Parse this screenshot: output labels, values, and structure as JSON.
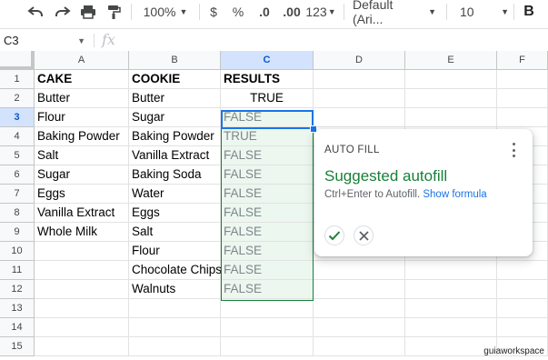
{
  "toolbar": {
    "zoom": "100%",
    "currency_symbol": "$",
    "percent_symbol": "%",
    "decrease_decimal": ".0",
    "increase_decimal": ".00",
    "number_format": "123",
    "font": "Default (Ari...",
    "font_size": "10",
    "bold": "B"
  },
  "formula_bar": {
    "cell_ref": "C3",
    "fx": "fx"
  },
  "columns": [
    "A",
    "B",
    "C",
    "D",
    "E",
    "F"
  ],
  "rows": [
    "1",
    "2",
    "3",
    "4",
    "5",
    "6",
    "7",
    "8",
    "9",
    "10",
    "11",
    "12",
    "13",
    "14",
    "15"
  ],
  "cells": {
    "A": [
      "CAKE",
      "Butter",
      "Flour",
      "Baking Powder",
      "Salt",
      "Sugar",
      "Eggs",
      "Vanilla Extract",
      "Whole Milk"
    ],
    "B": [
      "COOKIE",
      "Butter",
      "Sugar",
      "Baking Powder",
      "Vanilla Extract",
      "Baking Soda",
      "Water",
      "Eggs",
      "Salt",
      "Flour",
      "Chocolate Chips",
      "Walnuts"
    ],
    "C": [
      "RESULTS",
      "TRUE",
      "FALSE",
      "TRUE",
      "FALSE",
      "FALSE",
      "FALSE",
      "FALSE",
      "FALSE",
      "FALSE",
      "FALSE",
      "FALSE"
    ]
  },
  "selected_cell": {
    "column": "C",
    "row": "3"
  },
  "autofill_card": {
    "title": "AUTO FILL",
    "heading": "Suggested autofill",
    "subtitle": "Ctrl+Enter to Autofill.",
    "link": "Show formula",
    "accept_icon": "check-icon",
    "dismiss_icon": "close-icon"
  },
  "colors": {
    "suggest_green": "#188038",
    "selection_blue": "#1a73e8",
    "link_blue": "#1a73e8"
  },
  "watermark": "guiaworkspace"
}
